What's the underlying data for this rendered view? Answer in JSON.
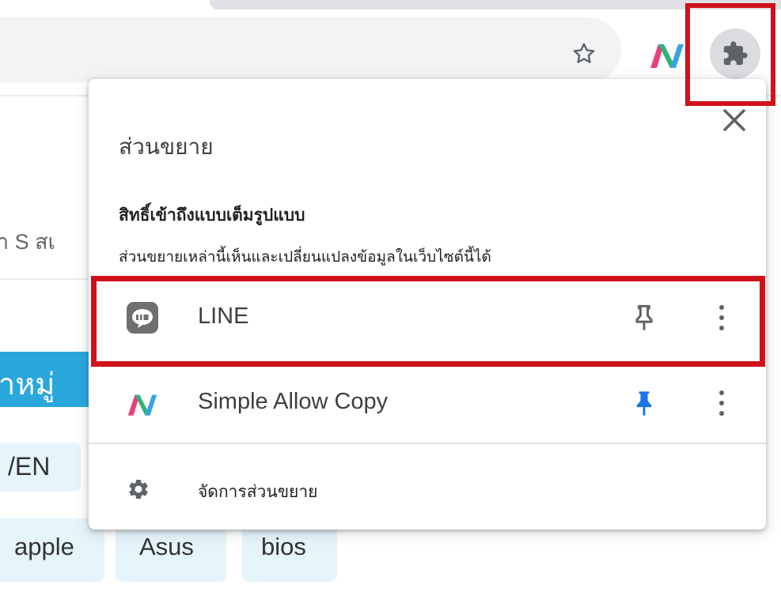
{
  "background": {
    "text_fragment": "า S สเ",
    "category_banner": "าหมู่",
    "chips": [
      "/EN",
      "apple",
      "Asus",
      "bios"
    ]
  },
  "toolbar": {
    "bookmark_icon": "star-outline-icon",
    "pinned_extension_icon": "simple-allow-copy-logo",
    "extensions_icon": "puzzle-icon"
  },
  "popup": {
    "title": "ส่วนขยาย",
    "section_heading": "สิทธิ์เข้าถึงแบบเต็มรูปแบบ",
    "section_description": "ส่วนขยายเหล่านี้เห็นและเปลี่ยนแปลงข้อมูลในเว็บไซต์นี้ได้",
    "extensions": [
      {
        "name": "LINE",
        "icon": "line-app-icon",
        "pinned": false
      },
      {
        "name": "Simple Allow Copy",
        "icon": "simple-allow-copy-logo",
        "pinned": true
      }
    ],
    "manage_label": "จัดการส่วนขยาย"
  },
  "colors": {
    "highlight_red": "#d0121b",
    "pin_active_blue": "#1a73e8",
    "icon_grey": "#5f6368",
    "banner_blue": "#2aa7dc"
  }
}
